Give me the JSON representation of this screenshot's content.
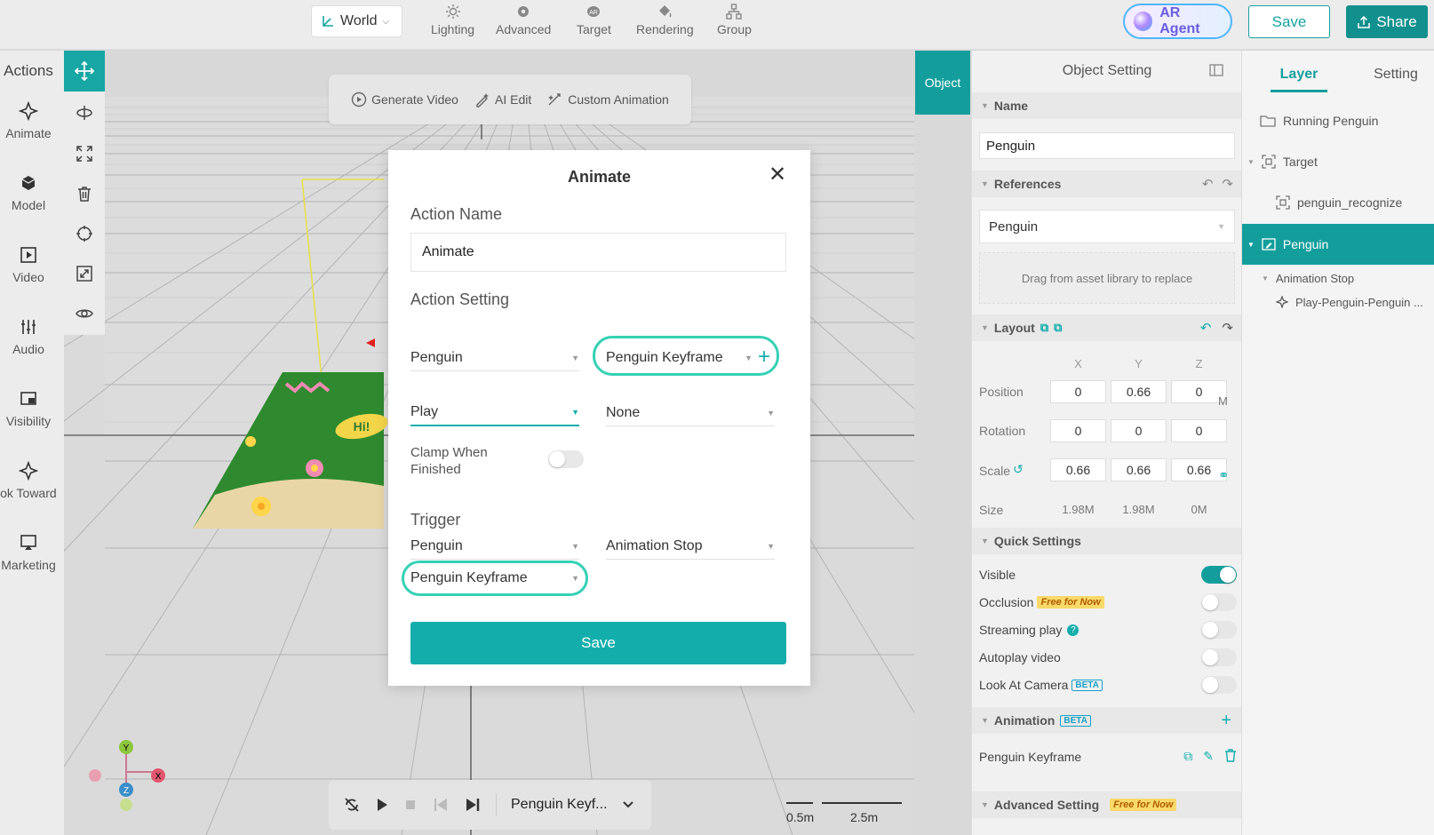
{
  "topbar": {
    "world_label": "World",
    "tools": [
      {
        "label": "Lighting",
        "icon": "sun-icon"
      },
      {
        "label": "Advanced",
        "icon": "gear-icon"
      },
      {
        "label": "Target",
        "icon": "target-icon"
      },
      {
        "label": "Rendering",
        "icon": "paint-bucket-icon"
      },
      {
        "label": "Group",
        "icon": "group-icon"
      }
    ],
    "ar_agent": "AR Agent",
    "save": "Save",
    "share": "Share"
  },
  "actions_panel": {
    "title": "Actions",
    "items": [
      {
        "label": "Animate",
        "icon": "sparkle-icon"
      },
      {
        "label": "Model",
        "icon": "cube-icon"
      },
      {
        "label": "Video",
        "icon": "play-square-icon"
      },
      {
        "label": "Audio",
        "icon": "sliders-icon"
      },
      {
        "label": "Visibility",
        "icon": "visibility-icon"
      },
      {
        "label": "ook Toward",
        "icon": "look-toward-icon"
      },
      {
        "label": "Marketing",
        "icon": "marketing-icon"
      }
    ]
  },
  "viewport": {
    "floating_toolbar": [
      {
        "label": "Generate Video",
        "icon": "generate-video-icon"
      },
      {
        "label": "AI Edit",
        "icon": "ai-edit-icon"
      },
      {
        "label": "Custom Animation",
        "icon": "custom-animation-icon"
      }
    ],
    "object_tab": "Object",
    "billboard_text": "Hi!",
    "gizmo": {
      "x": "X",
      "y": "Y",
      "z": "Z"
    },
    "playback": {
      "track_label": "Penguin Keyf..."
    },
    "ruler": {
      "left": "0.5m",
      "right": "2.5m"
    }
  },
  "modal": {
    "title": "Animate",
    "action_name_label": "Action Name",
    "action_name_value": "Animate",
    "action_setting_label": "Action Setting",
    "target_object": "Penguin",
    "animation": "Penguin Keyframe",
    "play_mode": "Play",
    "loop_mode": "None",
    "clamp_label": "Clamp When Finished",
    "trigger_label": "Trigger",
    "trigger_object": "Penguin",
    "trigger_event": "Animation Stop",
    "trigger_animation": "Penguin Keyframe",
    "save": "Save"
  },
  "object_setting": {
    "title": "Object Setting",
    "name_section": "Name",
    "name_value": "Penguin",
    "references_section": "References",
    "reference_value": "Penguin",
    "drag_hint": "Drag from asset library to replace",
    "layout_section": "Layout",
    "axes": [
      "X",
      "Y",
      "Z"
    ],
    "position_label": "Position",
    "position": [
      "0",
      "0.66",
      "0"
    ],
    "unit": "M",
    "rotation_label": "Rotation",
    "rotation": [
      "0",
      "0",
      "0"
    ],
    "scale_label": "Scale",
    "scale": [
      "0.66",
      "0.66",
      "0.66"
    ],
    "size_label": "Size",
    "size": [
      "1.98M",
      "1.98M",
      "0M"
    ],
    "quick_settings_section": "Quick Settings",
    "quick": [
      {
        "label": "Visible",
        "on": true
      },
      {
        "label": "Occlusion",
        "badge": "Free for Now",
        "on": false
      },
      {
        "label": "Streaming play",
        "on": false
      },
      {
        "label": "Autoplay video",
        "on": false
      },
      {
        "label": "Look At Camera",
        "badge": "BETA",
        "on": false
      }
    ],
    "animation_section": "Animation",
    "animation_badge": "BETA",
    "animation_item": "Penguin Keyframe",
    "advanced_section": "Advanced Setting",
    "advanced_badge": "Free for Now"
  },
  "layers": {
    "tabs": [
      "Layer",
      "Setting"
    ],
    "active_tab": "Layer",
    "items": [
      {
        "label": "Running Penguin",
        "icon": "folder-icon"
      },
      {
        "label": "Target",
        "icon": "target-frame-icon"
      },
      {
        "label": "penguin_recognize",
        "icon": "target-frame-icon"
      },
      {
        "label": "Penguin",
        "icon": "image-edit-icon"
      },
      {
        "label": "Animation Stop",
        "icon": ""
      },
      {
        "label": "Play-Penguin-Penguin ...",
        "icon": "sparkle-icon"
      }
    ]
  },
  "colors": {
    "accent": "#13aeac",
    "selected_layer": "#139e9c",
    "highlight_ring": "#35d1b5"
  }
}
